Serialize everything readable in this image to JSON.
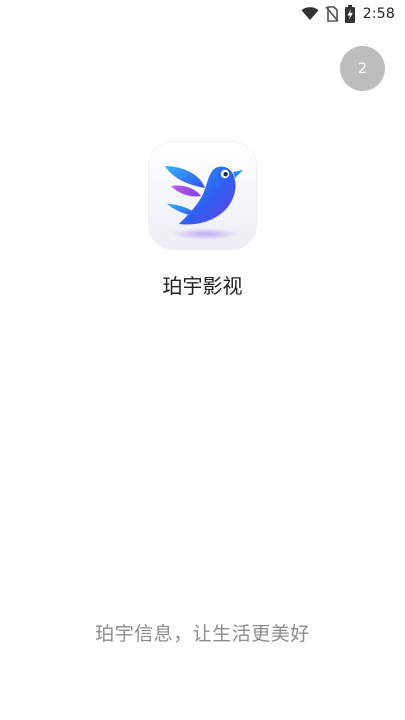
{
  "status_bar": {
    "time": "2:58",
    "icons": [
      "wifi-icon",
      "no-sim-icon",
      "battery-charging-icon"
    ]
  },
  "skip_countdown": "2",
  "app": {
    "name": "珀宇影视",
    "logo_icon": "bird-logo-icon"
  },
  "slogan": "珀宇信息，让生活更美好",
  "colors": {
    "skip_badge": "#bdbdbd",
    "slogan_text": "#8c8c8c",
    "logo_blue": "#2f6df0",
    "logo_purple": "#7b45e8"
  }
}
